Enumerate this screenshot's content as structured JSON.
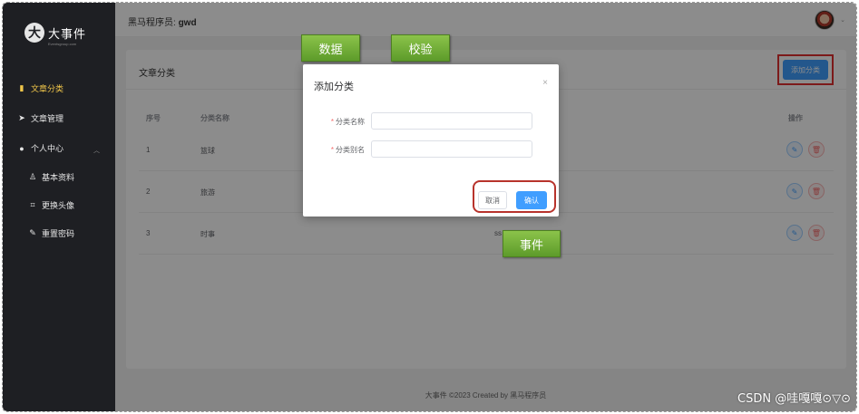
{
  "sidebar": {
    "logo_text": "大事件",
    "logo_mark": "大",
    "logo_sub": "Eventsgroup.com",
    "items": [
      {
        "label": "文章分类",
        "icon": "grid-icon",
        "glyph": "▮"
      },
      {
        "label": "文章管理",
        "icon": "send-icon",
        "glyph": "➤"
      },
      {
        "label": "个人中心",
        "icon": "user-icon",
        "glyph": "●"
      },
      {
        "label": "基本资料",
        "icon": "person-icon",
        "glyph": "♙"
      },
      {
        "label": "更换头像",
        "icon": "crop-icon",
        "glyph": "⌗"
      },
      {
        "label": "重置密码",
        "icon": "pen-icon",
        "glyph": "✎"
      }
    ],
    "active_color": "#f0c64a"
  },
  "header": {
    "user_prefix": "黑马程序员:",
    "user_name": "gwd"
  },
  "card": {
    "title": "文章分类",
    "add_button": "添加分类",
    "columns": [
      "序号",
      "分类名称",
      "操作"
    ],
    "rows": [
      {
        "index": "1",
        "name": "篮球",
        "alias": ""
      },
      {
        "index": "2",
        "name": "旅游",
        "alias": ""
      },
      {
        "index": "3",
        "name": "时事",
        "alias": "ss"
      }
    ]
  },
  "footer": "大事件 ©2023 Created by 黑马程序员",
  "dialog": {
    "title": "添加分类",
    "close": "×",
    "fields": [
      {
        "label": "分类名称",
        "value": ""
      },
      {
        "label": "分类别名",
        "value": ""
      }
    ],
    "cancel": "取消",
    "confirm": "确认"
  },
  "annotations": {
    "tag1": "数据",
    "tag2": "校验",
    "tag3": "事件",
    "highlight_color": "#e23030"
  },
  "watermark": "CSDN @哇嘎嘎⊙▽⊙",
  "colors": {
    "primary": "#409eff",
    "sidebar_bg": "#1e1f23",
    "danger": "#f56c6c"
  }
}
